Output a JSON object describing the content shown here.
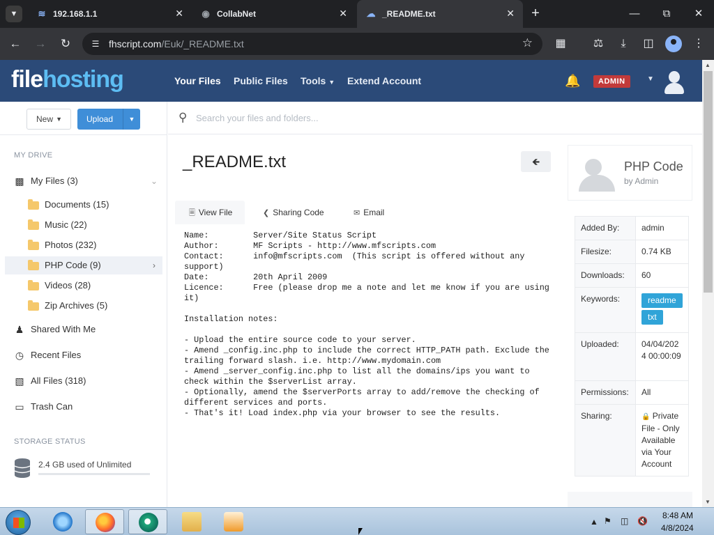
{
  "browser": {
    "tabs": [
      {
        "title": "192.168.1.1",
        "icon": "wifi-icon",
        "active": false
      },
      {
        "title": "CollabNet",
        "icon": "globe-icon",
        "active": false
      },
      {
        "title": "_README.txt",
        "icon": "cloud-icon",
        "active": true
      }
    ],
    "url_host": "fhscript.com",
    "url_path": "/Euk/_README.txt"
  },
  "site": {
    "logo_part1": "file",
    "logo_part2": "hosting",
    "nav": [
      "Your Files",
      "Public Files",
      "Tools",
      "Extend Account"
    ],
    "admin_badge": "ADMIN"
  },
  "sidebar": {
    "new_label": "New",
    "upload_label": "Upload",
    "my_drive_heading": "MY DRIVE",
    "my_files": "My Files (3)",
    "folders": [
      {
        "label": "Documents (15)"
      },
      {
        "label": "Music (22)"
      },
      {
        "label": "Photos (232)"
      },
      {
        "label": "PHP Code (9)",
        "selected": true
      },
      {
        "label": "Videos (28)"
      },
      {
        "label": "Zip Archives (5)"
      }
    ],
    "links": [
      "Shared With Me",
      "Recent Files",
      "All Files (318)",
      "Trash Can"
    ],
    "storage_heading": "STORAGE STATUS",
    "storage_text": "2.4 GB used of Unlimited",
    "storage_fraction": 0.0
  },
  "search": {
    "placeholder": "Search your files and folders..."
  },
  "file": {
    "title": "_README.txt",
    "tabs": [
      "View File",
      "Sharing Code",
      "Email"
    ],
    "content": "Name:         Server/Site Status Script\nAuthor:       MF Scripts - http://www.mfscripts.com\nContact:      info@mfscripts.com  (This script is offered without any support)\nDate:         20th April 2009\nLicence:      Free (please drop me a note and let me know if you are using it)\n\nInstallation notes:\n\n- Upload the entire source code to your server.\n- Amend _config.inc.php to include the correct HTTP_PATH path. Exclude the trailing forward slash. i.e. http://www.mydomain.com\n- Amend _server_config.inc.php to list all the domains/ips you want to check within the $serverList array.\n- Optionally, amend the $serverPorts array to add/remove the checking of different services and ports.\n- That's it! Load index.php via your browser to see the results."
  },
  "details": {
    "owner_title": "PHP Code",
    "owner_sub": "by Admin",
    "rows": {
      "added_by": {
        "k": "Added By:",
        "v": "admin"
      },
      "filesize": {
        "k": "Filesize:",
        "v": "0.74 KB"
      },
      "downloads": {
        "k": "Downloads:",
        "v": "60"
      },
      "keywords": {
        "k": "Keywords:",
        "v1": "readme",
        "v2": "txt"
      },
      "uploaded": {
        "k": "Uploaded:",
        "v": "04/04/2024 00:00:09"
      },
      "permissions": {
        "k": "Permissions:",
        "v": "All"
      },
      "sharing": {
        "k": "Sharing:",
        "v": "Private File - Only Available via Your Account"
      }
    }
  },
  "taskbar": {
    "time": "8:48 AM",
    "date": "4/8/2024"
  },
  "colors": {
    "header": "#2b4a78",
    "accent": "#3f8ed8",
    "keyword": "#30a4d8",
    "admin_badge": "#c23a3a"
  }
}
